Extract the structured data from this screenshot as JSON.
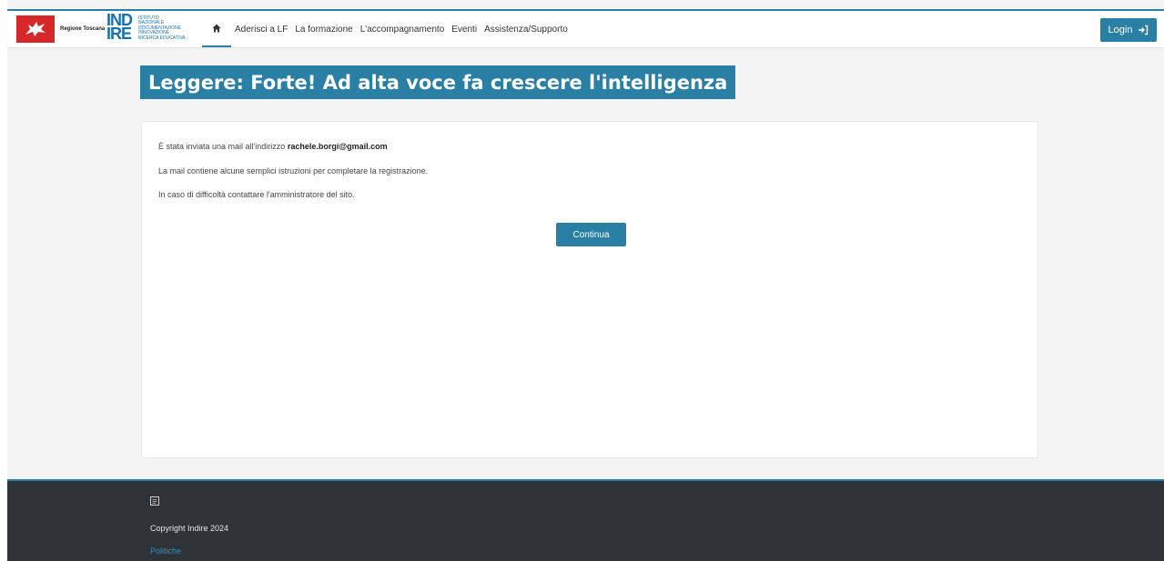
{
  "header": {
    "logo_region_label": "Regione Toscana",
    "logo_indire_line1": "IND",
    "logo_indire_line2": "IRE",
    "logo_indire_subtitle": [
      "ISTITUTO",
      "NAZIONALE",
      "DOCUMENTAZIONE",
      "INNOVAZIONE",
      "RICERCA EDUCATIVA"
    ],
    "nav_items": [
      "Aderisci a LF",
      "La formazione",
      "L'accompagnamento",
      "Eventi",
      "Assistenza/Supporto"
    ],
    "home_icon": "home-icon",
    "login_label": "Login",
    "login_icon": "sign-in-icon",
    "accent_color": "#2a7fa5"
  },
  "main": {
    "title": "Leggere: Forte! Ad alta voce fa crescere l'intelligenza",
    "message_line1_prefix": "È stata inviata una mail all'indirizzo",
    "message_email": "rachele.borgi@gmail.com",
    "message_line2": "La mail contiene alcune semplici istruzioni per completare la registrazione.",
    "message_line3": "In caso di difficoltà contattare l'amministratore del sito.",
    "continue_label": "Continua"
  },
  "footer": {
    "icon": "calendar-icon",
    "copyright": "Copyright Indire 2024",
    "policy_link": "Politiche",
    "background_color": "#2e3338",
    "link_color": "#2a8fc5"
  }
}
